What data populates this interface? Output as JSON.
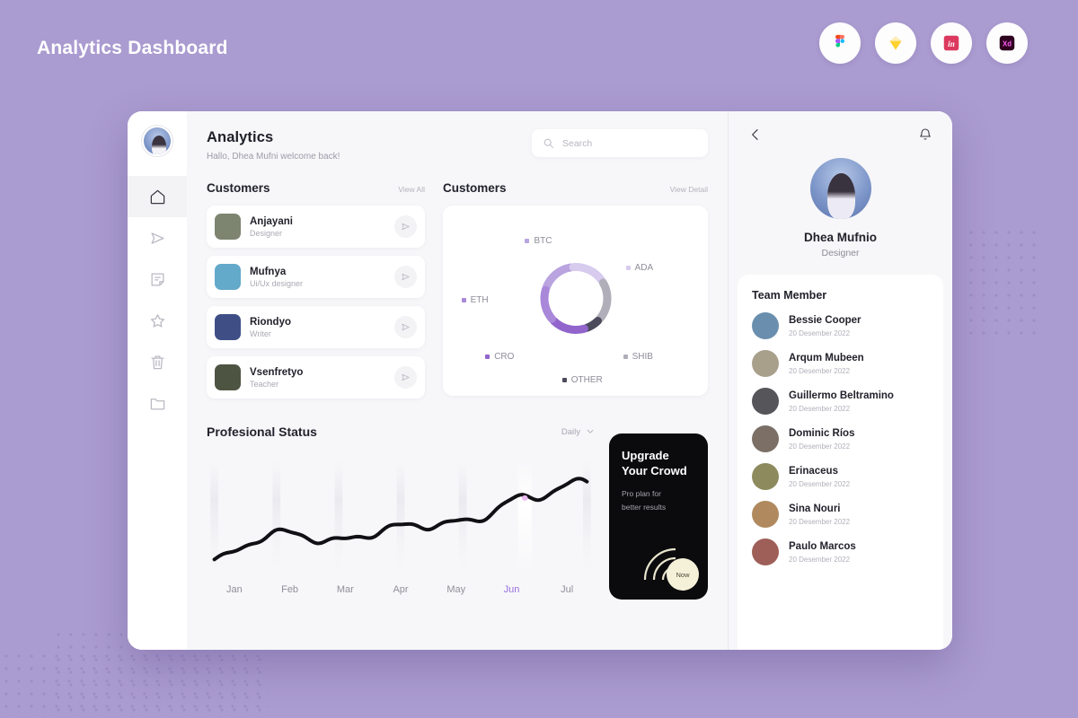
{
  "page": {
    "title": "Analytics Dashboard",
    "bg_color": "#aa9bd0"
  },
  "app_icons": [
    {
      "name": "figma-icon",
      "label": "Figma"
    },
    {
      "name": "sketch-icon",
      "label": "Sketch"
    },
    {
      "name": "invision-icon",
      "label": "InVision"
    },
    {
      "name": "adobe-xd-icon",
      "label": "Adobe XD"
    }
  ],
  "sidebar": {
    "items": [
      {
        "name": "home",
        "icon": "home-icon",
        "active": true
      },
      {
        "name": "send",
        "icon": "send-icon",
        "active": false
      },
      {
        "name": "notes",
        "icon": "note-icon",
        "active": false
      },
      {
        "name": "favorites",
        "icon": "star-icon",
        "active": false
      },
      {
        "name": "trash",
        "icon": "trash-icon",
        "active": false
      },
      {
        "name": "files",
        "icon": "folder-icon",
        "active": false
      }
    ]
  },
  "header": {
    "title": "Analytics",
    "subtitle": "Hallo, Dhea Mufni welcome back!",
    "search_placeholder": "Search",
    "search_value": ""
  },
  "customers_section": {
    "title": "Customers",
    "link": "View All",
    "items": [
      {
        "name": "Anjayani",
        "role": "Designer",
        "color": "#7d8470"
      },
      {
        "name": "Mufnya",
        "role": "Ui/Ux designer",
        "color": "#63a9c9"
      },
      {
        "name": "Riondyo",
        "role": "Writer",
        "color": "#3f4f86"
      },
      {
        "name": "Vsenfretyo",
        "role": "Teacher",
        "color": "#4e5442"
      }
    ]
  },
  "chart_section": {
    "title": "Customers",
    "link": "View Detail"
  },
  "status_section": {
    "title": "Profesional Status",
    "period": "Daily",
    "months": [
      "Jan",
      "Feb",
      "Mar",
      "Apr",
      "May",
      "Jun",
      "Jul"
    ],
    "active_month": "Jun"
  },
  "upgrade_card": {
    "title_line1": "Upgrade",
    "title_line2": "Your Crowd",
    "sub_line1": "Pro plan for",
    "sub_line2": "better results",
    "badge": "Now"
  },
  "right_panel": {
    "back_icon": "chevron-left-icon",
    "bell_icon": "bell-icon",
    "profile": {
      "name": "Dhea Mufnio",
      "role": "Designer"
    },
    "team_title": "Team Member",
    "team": [
      {
        "name": "Bessie Cooper",
        "date": "20 Desember 2022",
        "color": "#6a8fae"
      },
      {
        "name": "Arqum Mubeen",
        "date": "20 Desember 2022",
        "color": "#a9a08c"
      },
      {
        "name": "Guillermo Beltramino",
        "date": "20 Desember 2022",
        "color": "#55555a"
      },
      {
        "name": "Dominic Ríos",
        "date": "20 Desember 2022",
        "color": "#7b6f66"
      },
      {
        "name": "Erinaceus",
        "date": "20 Desember 2022",
        "color": "#8d8b5e"
      },
      {
        "name": "Sina Nouri",
        "date": "20 Desember 2022",
        "color": "#b08a5e"
      },
      {
        "name": "Paulo Marcos",
        "date": "20 Desember 2022",
        "color": "#9e5f58"
      }
    ]
  },
  "chart_data": [
    {
      "type": "pie",
      "title": "Customers",
      "subtype": "donut",
      "legend_position": "around",
      "categories": [
        "BTC",
        "ADA",
        "SHIB",
        "OTHER",
        "CRO",
        "ETH"
      ],
      "values": [
        18,
        18,
        21,
        8,
        18,
        17
      ],
      "colors": [
        "#b9a4e0",
        "#d7cbee",
        "#b0aeb8",
        "#4b4b5c",
        "#9165cc",
        "#a987d9"
      ],
      "labels": [
        "BTC",
        "ADA",
        "SHIB",
        "OTHER",
        "CRO",
        "ETH"
      ]
    },
    {
      "type": "line",
      "title": "Profesional Status",
      "xlabel": "",
      "ylabel": "",
      "grid": false,
      "categories": [
        "Jan",
        "Feb",
        "Mar",
        "Apr",
        "May",
        "Jun",
        "Jul"
      ],
      "series": [
        {
          "name": "Status",
          "values": [
            12,
            38,
            30,
            44,
            48,
            72,
            88
          ],
          "color": "#111115"
        }
      ],
      "highlight_category": "Jun",
      "highlight_color": "#9a6fe0",
      "ylim": [
        0,
        100
      ]
    }
  ]
}
